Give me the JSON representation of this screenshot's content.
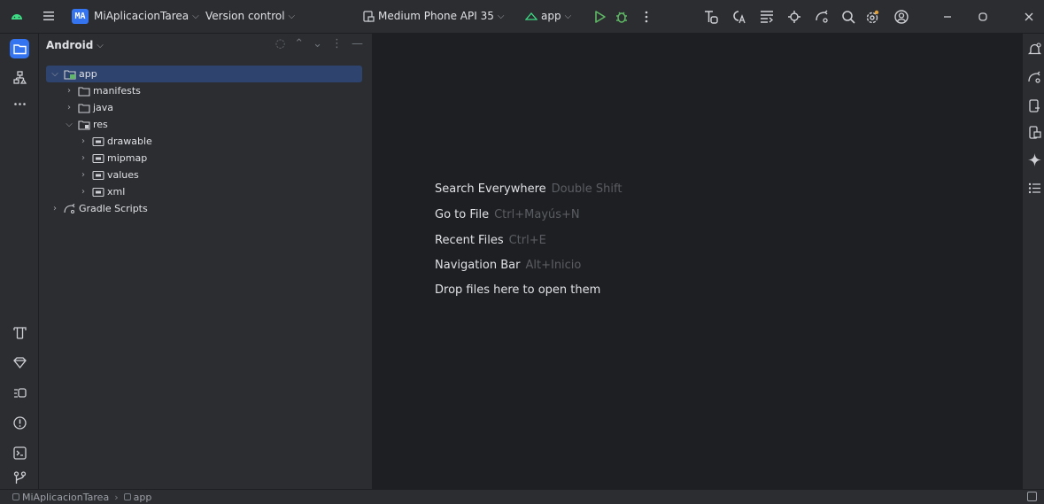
{
  "titlebar": {
    "project_badge": "MA",
    "project_name": "MiAplicacionTarea",
    "vcs_label": "Version control",
    "device_label": "Medium Phone API 35",
    "run_config": "app",
    "icons": [
      "android-logo",
      "main-menu",
      "device-manager",
      "run",
      "debug",
      "more",
      "layout-inspector",
      "translations",
      "structure",
      "gradle-sync",
      "gemini",
      "search",
      "settings",
      "account",
      "minimize",
      "restore",
      "close"
    ]
  },
  "left_strip": {
    "top_icons": [
      "project-icon",
      "structure-icon",
      "more-icon"
    ],
    "bottom_icons": [
      "resource-manager-icon",
      "gradle-icon",
      "app-quality-icon",
      "problems-icon",
      "terminal-icon",
      "git-icon"
    ]
  },
  "right_strip": {
    "icons": [
      "notifications-icon",
      "gradle-icon",
      "device-manager-icon",
      "running-devices-icon",
      "gemini-icon",
      "structure-icon"
    ]
  },
  "project_panel": {
    "view_selector": "Android",
    "tree": [
      {
        "label": "app",
        "depth": 0,
        "expanded": true,
        "icon": "module",
        "selected": true
      },
      {
        "label": "manifests",
        "depth": 1,
        "expanded": false,
        "icon": "folder"
      },
      {
        "label": "java",
        "depth": 1,
        "expanded": false,
        "icon": "folder"
      },
      {
        "label": "res",
        "depth": 1,
        "expanded": true,
        "icon": "res-folder"
      },
      {
        "label": "drawable",
        "depth": 2,
        "expanded": false,
        "icon": "res-subfolder"
      },
      {
        "label": "mipmap",
        "depth": 2,
        "expanded": false,
        "icon": "res-subfolder"
      },
      {
        "label": "values",
        "depth": 2,
        "expanded": false,
        "icon": "res-subfolder"
      },
      {
        "label": "xml",
        "depth": 2,
        "expanded": false,
        "icon": "res-subfolder"
      },
      {
        "label": "Gradle Scripts",
        "depth": 0,
        "expanded": false,
        "icon": "gradle"
      }
    ]
  },
  "editor": {
    "hints": [
      {
        "action": "Search Everywhere",
        "shortcut": "Double Shift"
      },
      {
        "action": "Go to File",
        "shortcut": "Ctrl+Mayús+N"
      },
      {
        "action": "Recent Files",
        "shortcut": "Ctrl+E"
      },
      {
        "action": "Navigation Bar",
        "shortcut": "Alt+Inicio"
      },
      {
        "action": "Drop files here to open them",
        "shortcut": ""
      }
    ]
  },
  "statusbar": {
    "breadcrumb": [
      "MiAplicacionTarea",
      "app"
    ]
  }
}
